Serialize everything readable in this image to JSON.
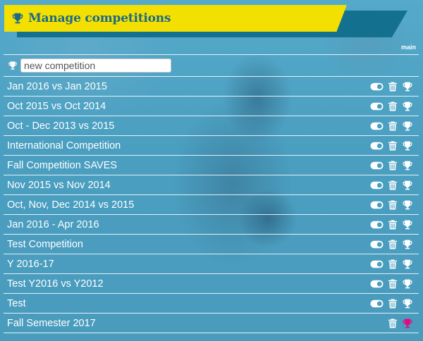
{
  "header": {
    "title": "Manage competitions",
    "title_icon": "trophy-icon"
  },
  "context_label": "main",
  "new_competition": {
    "placeholder": "new competition",
    "icon": "trophy-icon"
  },
  "competitions": [
    {
      "name": "Jan 2016 vs Jan 2015",
      "icons": [
        "toggle-icon",
        "trash-icon",
        "trophy-icon"
      ]
    },
    {
      "name": "Oct 2015 vs Oct 2014",
      "icons": [
        "toggle-icon",
        "trash-icon",
        "trophy-icon"
      ]
    },
    {
      "name": "Oct - Dec 2013 vs 2015",
      "icons": [
        "toggle-icon",
        "trash-icon",
        "trophy-icon"
      ]
    },
    {
      "name": "International Competition",
      "icons": [
        "toggle-icon",
        "trash-icon",
        "trophy-icon"
      ]
    },
    {
      "name": "Fall Competition SAVES",
      "icons": [
        "toggle-icon",
        "trash-icon",
        "trophy-icon"
      ]
    },
    {
      "name": "Nov 2015 vs Nov 2014",
      "icons": [
        "toggle-icon",
        "trash-icon",
        "trophy-icon"
      ]
    },
    {
      "name": "Oct, Nov, Dec 2014 vs 2015",
      "icons": [
        "toggle-icon",
        "trash-icon",
        "trophy-icon"
      ]
    },
    {
      "name": "Jan 2016 - Apr 2016",
      "icons": [
        "toggle-icon",
        "trash-icon",
        "trophy-icon"
      ]
    },
    {
      "name": "Test Competition",
      "icons": [
        "toggle-icon",
        "trash-icon",
        "trophy-icon"
      ]
    },
    {
      "name": "Y 2016-17",
      "icons": [
        "toggle-icon",
        "trash-icon",
        "trophy-icon"
      ]
    },
    {
      "name": "Test Y2016 vs Y2012",
      "icons": [
        "toggle-icon",
        "trash-icon",
        "trophy-icon"
      ]
    },
    {
      "name": "Test",
      "icons": [
        "toggle-icon",
        "trash-icon",
        "trophy-icon"
      ]
    },
    {
      "name": "Fall Semester 2017",
      "icons": [
        "trash-icon",
        "trophy-icon"
      ],
      "active": true
    }
  ],
  "colors": {
    "banner_yellow": "#f3df00",
    "banner_dark": "#14708f",
    "title_text": "#1b6a8a",
    "row_text": "#ffffff",
    "active_trophy": "#e5097f"
  }
}
